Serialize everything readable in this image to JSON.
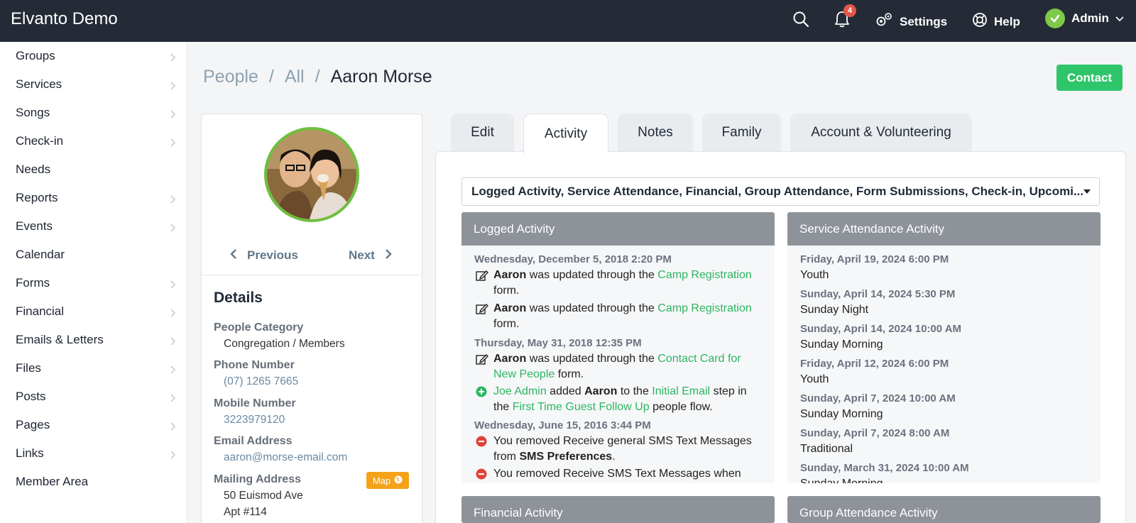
{
  "app": {
    "title": "Elvanto Demo"
  },
  "topbar": {
    "notifications_count": "4",
    "settings_label": "Settings",
    "help_label": "Help",
    "user_label": "Admin"
  },
  "sidebar": {
    "items": [
      {
        "label": "Groups"
      },
      {
        "label": "Services"
      },
      {
        "label": "Songs"
      },
      {
        "label": "Check-in"
      },
      {
        "label": "Needs"
      },
      {
        "label": "Reports"
      },
      {
        "label": "Events"
      },
      {
        "label": "Calendar"
      },
      {
        "label": "Forms"
      },
      {
        "label": "Financial"
      },
      {
        "label": "Emails & Letters"
      },
      {
        "label": "Files"
      },
      {
        "label": "Posts"
      },
      {
        "label": "Pages"
      },
      {
        "label": "Links"
      },
      {
        "label": "Member Area"
      }
    ]
  },
  "breadcrumb": {
    "people": "People",
    "sep": "/",
    "all": "All",
    "current": "Aaron Morse"
  },
  "contact_button": "Contact",
  "profile": {
    "previous": "Previous",
    "next": "Next",
    "details_title": "Details",
    "fields": {
      "category_label": "People Category",
      "category_value": "Congregation / Members",
      "phone_label": "Phone Number",
      "phone_value": "(07) 1265 7665",
      "mobile_label": "Mobile Number",
      "mobile_value": "3223979120",
      "email_label": "Email Address",
      "email_value": "aaron@morse-email.com",
      "mailing_label": "Mailing Address",
      "mailing_line1": "50 Euismod Ave",
      "mailing_line2": "Apt #114",
      "map_label": "Map"
    }
  },
  "tabs": [
    {
      "label": "Edit"
    },
    {
      "label": "Activity"
    },
    {
      "label": "Notes"
    },
    {
      "label": "Family"
    },
    {
      "label": "Account & Volunteering"
    }
  ],
  "filter_value": "Logged Activity, Service Attendance, Financial, Group Attendance, Form Submissions, Check-in, Upcomi...",
  "logged_activity": {
    "title": "Logged Activity",
    "date1": "Wednesday, December 5, 2018 2:20 PM",
    "date2": "Thursday, May 31, 2018 12:35 PM",
    "date3": "Wednesday, June 15, 2016 3:44 PM",
    "name": "Aaron",
    "updated_through": "was updated through the",
    "camp_registration": "Camp Registration",
    "form": "form.",
    "contact_card_1": "Contact Card for",
    "contact_card_2": "New People",
    "joe_admin": "Joe Admin",
    "added": "added",
    "to_the": "to the",
    "initial_email": "Initial Email",
    "step_in": "step in",
    "the": "the",
    "first_time": "First Time Guest Follow Up",
    "people_flow": "people flow.",
    "removed1a": "You removed Receive general SMS Text Messages",
    "removed1b": "from",
    "sms_prefs": "SMS Preferences",
    "period": ".",
    "removed2a": "You removed Receive SMS Text Messages when"
  },
  "service_attendance": {
    "title": "Service Attendance Activity",
    "entries": [
      {
        "date": "Friday, April 19, 2024 6:00 PM",
        "name": "Youth"
      },
      {
        "date": "Sunday, April 14, 2024 5:30 PM",
        "name": "Sunday Night"
      },
      {
        "date": "Sunday, April 14, 2024 10:00 AM",
        "name": "Sunday Morning"
      },
      {
        "date": "Friday, April 12, 2024 6:00 PM",
        "name": "Youth"
      },
      {
        "date": "Sunday, April 7, 2024 10:00 AM",
        "name": "Sunday Morning"
      },
      {
        "date": "Sunday, April 7, 2024 8:00 AM",
        "name": "Traditional"
      },
      {
        "date": "Sunday, March 31, 2024 10:00 AM",
        "name": "Sunday Morning"
      }
    ]
  },
  "financial_activity": {
    "title": "Financial Activity"
  },
  "group_attendance": {
    "title": "Group Attendance Activity"
  },
  "colors": {
    "topbar": "#252b36",
    "accent_green": "#2ec56b",
    "link_green": "#2db562",
    "map_orange": "#f5a21b",
    "panel_header": "#8e9299"
  }
}
